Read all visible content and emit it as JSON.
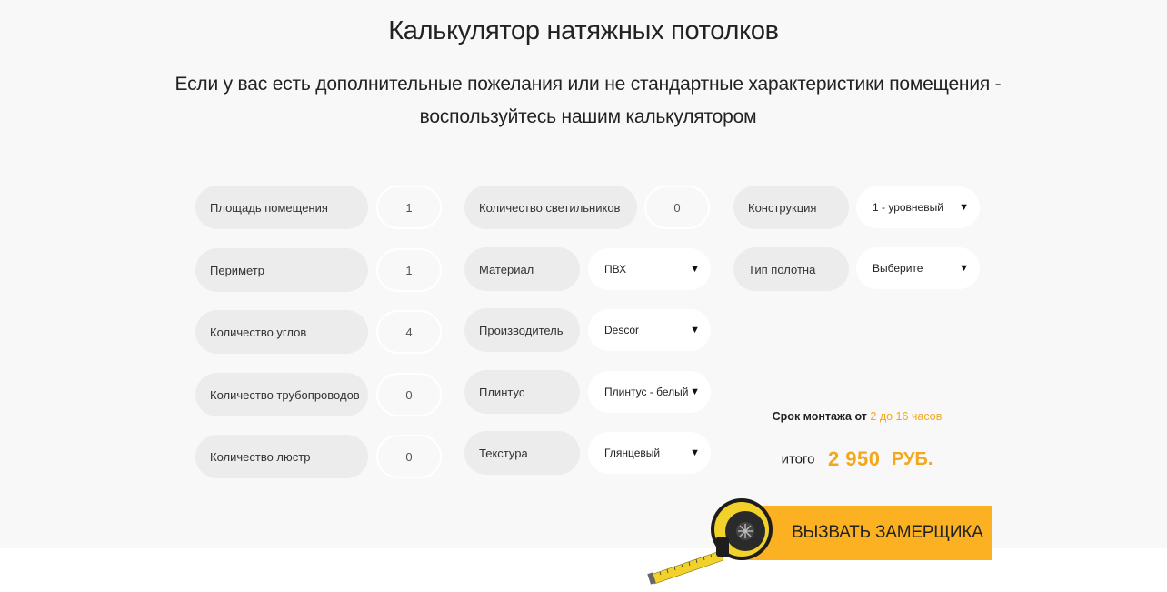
{
  "header": {
    "title": "Калькулятор натяжных потолков",
    "subtitle_line1": "Если у вас есть дополнительные пожелания или не стандартные характеристики помещения -",
    "subtitle_line2": "воспользуйтесь нашим калькулятором"
  },
  "col1": [
    {
      "label": "Площадь помещения",
      "value": "1"
    },
    {
      "label": "Периметр",
      "value": "1"
    },
    {
      "label": "Количество углов",
      "value": "4"
    },
    {
      "label": "Количество трубопроводов",
      "value": "0"
    },
    {
      "label": "Количество люстр",
      "value": "0"
    }
  ],
  "col2": {
    "lamps": {
      "label": "Количество светильников",
      "value": "0"
    },
    "selects": [
      {
        "label": "Материал",
        "value": "ПВХ"
      },
      {
        "label": "Производитель",
        "value": "Descor"
      },
      {
        "label": "Плинтус",
        "value": "Плинтус - белый"
      },
      {
        "label": "Текстура",
        "value": "Глянцевый"
      }
    ]
  },
  "col3": [
    {
      "label": "Конструкция",
      "value": "1 - уровневый"
    },
    {
      "label": "Тип полотна",
      "value": "Выберите"
    }
  ],
  "summary": {
    "term_prefix": "Срок монтажа от",
    "term_value": "2 до 16 часов",
    "total_label": "итого",
    "total_amount": "2 950",
    "total_currency": "РУБ."
  },
  "cta": {
    "label": "ВЫЗВАТЬ ЗАМЕРЩИКА"
  },
  "icons": {
    "caret": "▼",
    "tape": "tape-measure-icon"
  },
  "colors": {
    "accent": "#fbb121",
    "accent_text": "#f3a81c",
    "pill_bg": "#ececec",
    "section_bg": "#f8f8f8"
  }
}
